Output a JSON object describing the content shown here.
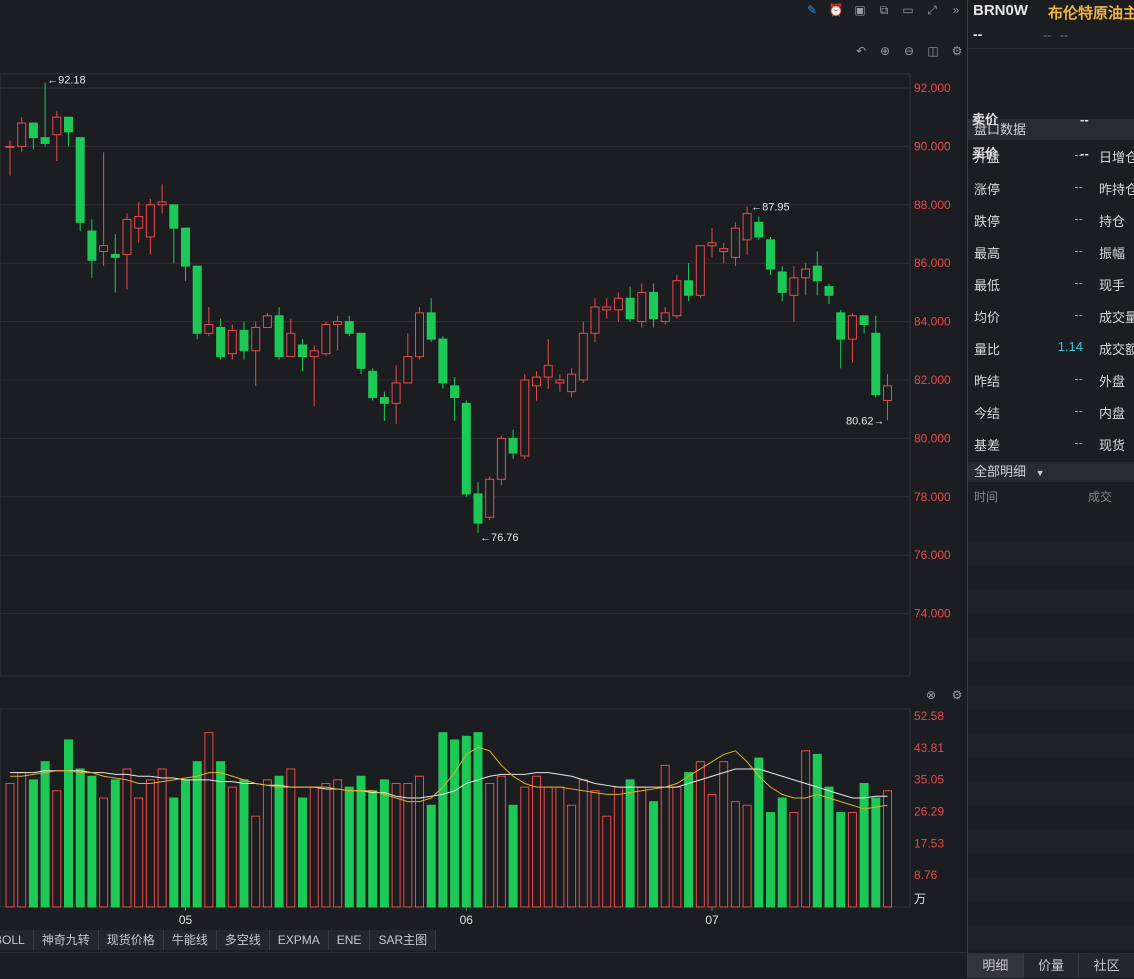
{
  "chart_data": {
    "type": "candlestick",
    "price_ticks": [
      "92.000",
      "90.000",
      "88.000",
      "86.000",
      "84.000",
      "82.000",
      "80.000",
      "78.000",
      "76.000",
      "74.000"
    ],
    "price_tick_values": [
      92,
      90,
      88,
      86,
      84,
      82,
      80,
      78,
      76,
      74
    ],
    "annotations": {
      "high": "92.18",
      "high2": "87.95",
      "low": "76.76",
      "last": "80.62"
    },
    "x_labels": [
      "05",
      "06",
      "07"
    ],
    "volume_ticks": [
      "52.58",
      "43.81",
      "35.05",
      "26.29",
      "17.53",
      "8.76"
    ],
    "volume_tick_values": [
      52.58,
      43.81,
      35.05,
      26.29,
      17.53,
      8.76
    ],
    "volume_unit": "万",
    "candles": [
      [
        90.0,
        90.0,
        90.2,
        89.0
      ],
      [
        90.0,
        90.8,
        91.0,
        89.8
      ],
      [
        90.8,
        90.3,
        90.5,
        89.9
      ],
      [
        90.3,
        90.1,
        92.18,
        90.0
      ],
      [
        90.4,
        91.0,
        91.2,
        89.5
      ],
      [
        91.0,
        90.5,
        91.0,
        90.0
      ],
      [
        90.3,
        87.4,
        90.3,
        87.1
      ],
      [
        87.1,
        86.1,
        87.5,
        85.5
      ],
      [
        86.4,
        86.6,
        89.8,
        85.9
      ],
      [
        86.3,
        86.2,
        87.0,
        85.0
      ],
      [
        86.3,
        87.5,
        87.7,
        85.1
      ],
      [
        87.2,
        87.6,
        88.1,
        86.7
      ],
      [
        86.9,
        88.0,
        88.2,
        86.3
      ],
      [
        88.0,
        88.1,
        88.7,
        87.7
      ],
      [
        88.0,
        87.2,
        88.0,
        86.0
      ],
      [
        87.2,
        85.9,
        87.2,
        85.4
      ],
      [
        85.9,
        83.6,
        85.9,
        83.4
      ],
      [
        83.6,
        83.9,
        84.5,
        83.5
      ],
      [
        83.8,
        82.8,
        84.1,
        82.7
      ],
      [
        82.9,
        83.7,
        83.9,
        82.7
      ],
      [
        83.7,
        83.0,
        84.0,
        82.7
      ],
      [
        83.0,
        83.8,
        84.0,
        81.8
      ],
      [
        83.8,
        84.2,
        84.3,
        83.8
      ],
      [
        84.2,
        82.8,
        84.5,
        82.7
      ],
      [
        82.8,
        83.6,
        84.1,
        82.8
      ],
      [
        83.2,
        82.8,
        83.4,
        82.3
      ],
      [
        82.8,
        83.0,
        83.2,
        81.1
      ],
      [
        82.9,
        83.9,
        84.0,
        82.8
      ],
      [
        83.9,
        84.0,
        84.2,
        83.0
      ],
      [
        84.0,
        83.6,
        84.2,
        83.5
      ],
      [
        83.6,
        82.4,
        83.6,
        82.2
      ],
      [
        82.3,
        81.4,
        82.4,
        81.3
      ],
      [
        81.4,
        81.2,
        81.6,
        80.6
      ],
      [
        81.2,
        81.9,
        82.5,
        80.5
      ],
      [
        81.9,
        82.8,
        83.6,
        81.9
      ],
      [
        82.8,
        84.3,
        84.5,
        82.7
      ],
      [
        84.3,
        83.4,
        84.8,
        83.3
      ],
      [
        83.4,
        81.9,
        83.5,
        81.7
      ],
      [
        81.8,
        81.4,
        82.1,
        80.6
      ],
      [
        81.2,
        78.1,
        81.3,
        78.0
      ],
      [
        78.1,
        77.1,
        78.5,
        76.76
      ],
      [
        77.3,
        78.6,
        78.7,
        77.2
      ],
      [
        78.6,
        80.0,
        80.1,
        78.4
      ],
      [
        80.0,
        79.5,
        80.3,
        79.3
      ],
      [
        79.4,
        82.0,
        82.2,
        79.3
      ],
      [
        81.8,
        82.1,
        82.3,
        81.3
      ],
      [
        82.1,
        82.5,
        83.4,
        81.7
      ],
      [
        81.9,
        82.0,
        82.2,
        81.6
      ],
      [
        81.6,
        82.2,
        82.4,
        81.4
      ],
      [
        82.0,
        83.6,
        84.0,
        81.9
      ],
      [
        83.6,
        84.5,
        84.8,
        83.3
      ],
      [
        84.4,
        84.5,
        84.8,
        84.1
      ],
      [
        84.4,
        84.8,
        85.0,
        84.0
      ],
      [
        84.8,
        84.1,
        85.2,
        84.0
      ],
      [
        84.0,
        85.0,
        85.3,
        83.8
      ],
      [
        85.0,
        84.1,
        85.3,
        83.8
      ],
      [
        84.0,
        84.3,
        84.5,
        83.9
      ],
      [
        84.2,
        85.4,
        85.6,
        84.1
      ],
      [
        85.4,
        84.9,
        86.0,
        84.7
      ],
      [
        84.9,
        86.6,
        86.6,
        84.8
      ],
      [
        86.6,
        86.7,
        87.2,
        86.2
      ],
      [
        86.4,
        86.5,
        86.7,
        86.0
      ],
      [
        86.2,
        87.2,
        87.4,
        85.9
      ],
      [
        86.8,
        87.7,
        87.95,
        86.3
      ],
      [
        87.4,
        86.9,
        87.6,
        86.8
      ],
      [
        86.8,
        85.8,
        86.9,
        85.6
      ],
      [
        85.7,
        85.0,
        85.9,
        84.7
      ],
      [
        84.9,
        85.5,
        85.9,
        84.0
      ],
      [
        85.5,
        85.8,
        86.0,
        84.9
      ],
      [
        85.9,
        85.4,
        86.4,
        84.9
      ],
      [
        85.2,
        84.9,
        85.3,
        84.6
      ],
      [
        84.3,
        83.4,
        84.4,
        82.4
      ],
      [
        83.4,
        84.2,
        84.3,
        82.6
      ],
      [
        84.2,
        83.9,
        84.2,
        83.6
      ],
      [
        83.6,
        81.5,
        84.2,
        81.4
      ],
      [
        81.3,
        81.8,
        82.2,
        80.62
      ]
    ],
    "volumes": [
      34,
      37,
      35,
      40,
      32,
      46,
      38,
      36,
      30,
      35,
      38,
      30,
      35,
      38,
      30,
      35,
      40,
      48,
      40,
      33,
      35,
      25,
      35,
      36,
      38,
      30,
      33,
      34,
      35,
      33,
      36,
      32,
      35,
      34,
      34,
      36,
      28,
      48,
      46,
      47,
      48,
      34,
      36,
      28,
      33,
      36,
      33,
      33,
      28,
      35,
      32,
      25,
      33,
      35,
      33,
      29,
      39,
      33,
      37,
      40,
      31,
      40,
      29,
      28,
      41,
      26,
      30,
      26,
      43,
      42,
      33,
      26,
      26,
      34,
      30,
      32
    ],
    "ma_white": [
      37,
      37,
      37,
      37.5,
      37.5,
      37.5,
      37.5,
      37,
      37,
      36.5,
      36.5,
      36,
      36,
      35.5,
      35.5,
      35,
      35,
      35,
      34.5,
      34.5,
      34,
      34,
      33.5,
      33.5,
      33,
      33,
      33,
      32.5,
      32.5,
      32,
      32,
      31.5,
      31.5,
      30.5,
      30,
      30,
      30.5,
      31,
      32,
      34,
      35,
      36,
      36.5,
      36.5,
      36.5,
      37,
      37,
      36.5,
      36,
      35,
      34,
      33.5,
      33,
      33,
      33,
      33,
      33,
      33,
      34,
      35,
      36,
      37,
      38,
      38,
      38,
      37,
      36,
      35,
      34,
      33,
      32,
      31,
      30,
      30,
      30.5,
      30.5
    ],
    "ma_yellow": [
      36,
      36,
      36.5,
      37,
      37.5,
      37.5,
      37,
      37,
      36,
      35.5,
      35,
      34,
      34,
      34.5,
      35,
      35.5,
      36,
      37,
      37,
      36,
      35,
      34,
      33.5,
      33,
      33,
      33,
      33,
      33,
      32.5,
      32,
      32,
      32,
      31,
      30,
      29,
      29,
      30,
      33,
      37,
      42,
      44,
      43,
      39,
      36,
      34,
      33,
      33,
      33,
      32.5,
      32,
      31.5,
      31,
      31,
      31.5,
      32,
      32.5,
      33,
      34,
      36,
      38,
      40,
      42,
      43,
      40,
      36,
      33,
      31,
      30,
      30,
      31,
      30,
      29,
      28,
      27,
      27.5,
      28
    ]
  },
  "toolbar_icons": [
    "pen-icon",
    "alarm-icon",
    "camera-icon",
    "copy-icon",
    "screen-icon",
    "fullscreen-icon",
    "collapse-icon"
  ],
  "chart_tools": [
    "undo-icon",
    "zoom-in-icon",
    "zoom-out-icon",
    "window-icon",
    "settings-icon"
  ],
  "indicator_tabs": [
    "BOLL",
    "神奇九转",
    "现货价格",
    "牛能线",
    "多空线",
    "EXPMA",
    "ENE",
    "SAR主图"
  ],
  "quote": {
    "code": "BRN0W",
    "name": "布伦特原油主",
    "price": "--",
    "change": "--",
    "change_pct": "--",
    "ask_label": "卖价",
    "ask_value": "--",
    "bid_label": "买价",
    "bid_value": "--",
    "section_title": "盘口数据",
    "rows": [
      {
        "l": "开盘",
        "v": "--",
        "c": false,
        "r": "日增仓"
      },
      {
        "l": "涨停",
        "v": "--",
        "c": true,
        "r": "昨持仓"
      },
      {
        "l": "跌停",
        "v": "--",
        "c": true,
        "r": "持仓"
      },
      {
        "l": "最高",
        "v": "--",
        "c": false,
        "r": "振幅"
      },
      {
        "l": "最低",
        "v": "--",
        "c": false,
        "r": "现手"
      },
      {
        "l": "均价",
        "v": "--",
        "c": false,
        "r": "成交量"
      },
      {
        "l": "量比",
        "v": "1.14",
        "c": true,
        "r": "成交额"
      },
      {
        "l": "昨结",
        "v": "--",
        "c": false,
        "r": "外盘"
      },
      {
        "l": "今结",
        "v": "--",
        "c": true,
        "r": "内盘"
      },
      {
        "l": "基差",
        "v": "--",
        "c": false,
        "r": "现货"
      }
    ],
    "detail_title": "全部明细",
    "detail_col_time": "时间",
    "detail_col_deal": "成交"
  },
  "bottom_tabs": [
    "明细",
    "价量",
    "社区"
  ],
  "colors": {
    "up": "#e84a4a",
    "down": "#1dc956",
    "accent": "#2ec7d6",
    "name": "#f0b340"
  }
}
